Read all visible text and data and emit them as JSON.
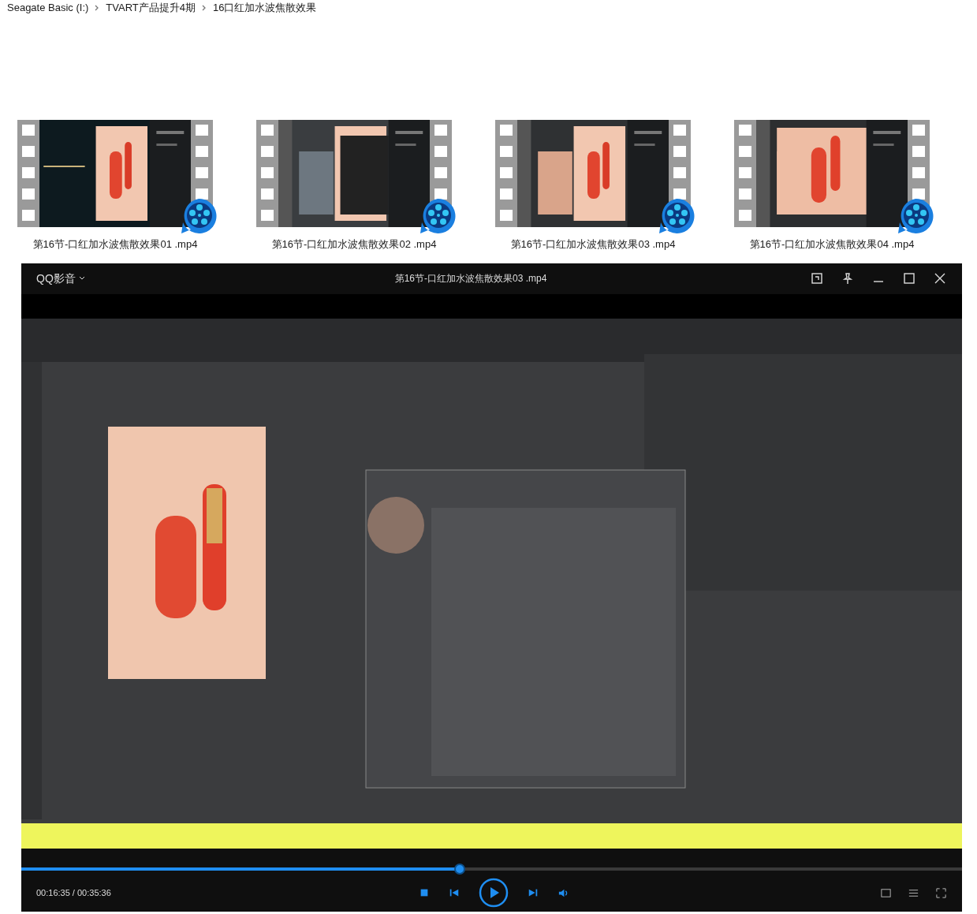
{
  "breadcrumb": [
    {
      "label": "Seagate Basic (I:)"
    },
    {
      "label": "TVART产品提升4期"
    },
    {
      "label": "16口红加水波焦散效果"
    }
  ],
  "files": [
    {
      "name": "第16节-口红加水波焦散效果01 .mp4"
    },
    {
      "name": "第16节-口红加水波焦散效果02 .mp4"
    },
    {
      "name": "第16节-口红加水波焦散效果03 .mp4"
    },
    {
      "name": "第16节-口红加水波焦散效果04 .mp4"
    }
  ],
  "player": {
    "app_name": "QQ影音",
    "title": "第16节-口红加水波焦散效果03 .mp4",
    "progress": {
      "level": 0.466
    },
    "time": "00:16:35 / 00:35:36"
  }
}
